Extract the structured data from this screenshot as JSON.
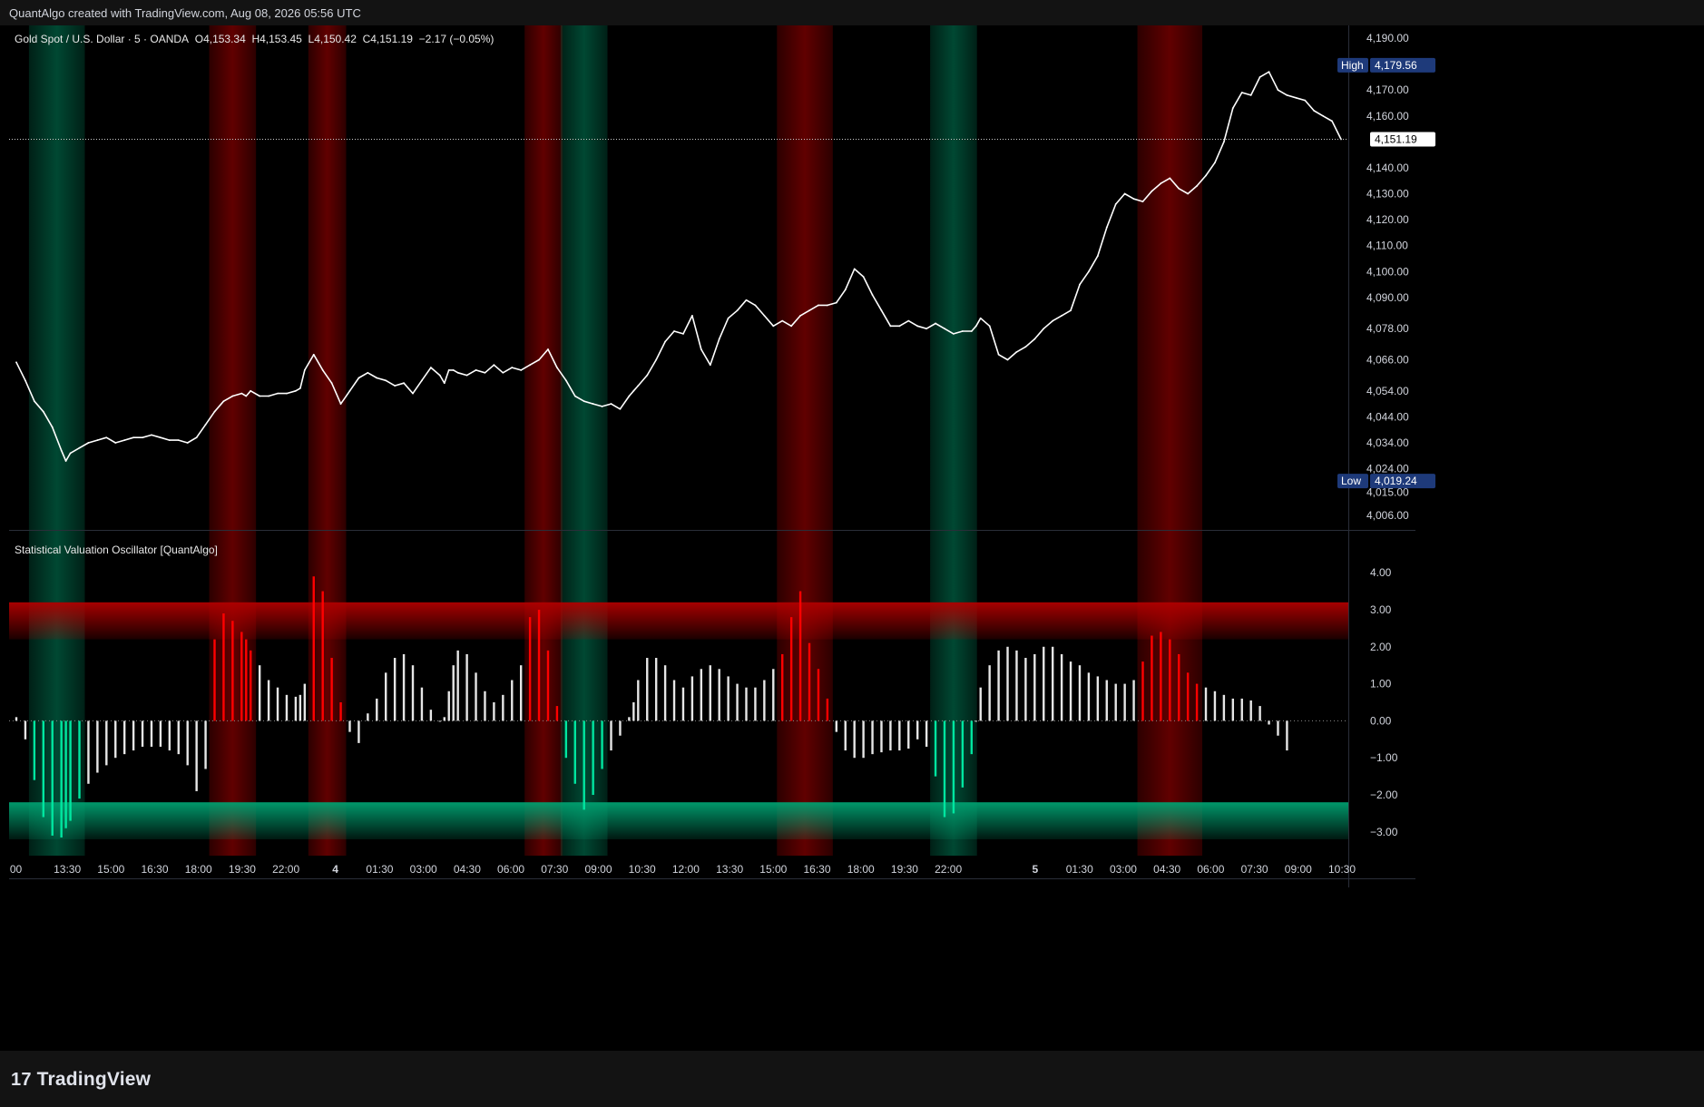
{
  "header": {
    "caption": "QuantAlgo created with TradingView.com, Aug 08, 2026 05:56 UTC"
  },
  "main_legend": {
    "symbol": "Gold Spot / U.S. Dollar · 5 · OANDA",
    "open": "O4,153.34",
    "high": "H4,153.45",
    "low": "L4,150.42",
    "close": "C4,151.19",
    "change": "−2.17 (−0.05%)"
  },
  "osc_legend": {
    "name": "Statistical Valuation Oscillator [QuantAlgo]"
  },
  "footer": {
    "logo_text": "TradingView",
    "logo_mark": "17"
  },
  "colors": {
    "background": "#000000",
    "price_line": "#ffffff",
    "osc_neutral": "#e6e6e6",
    "osc_over": "#ff0000",
    "osc_under": "#00e6a0",
    "red_zone": "#b00000",
    "green_zone": "#00a070",
    "badge": "#1e3a7a"
  },
  "chart_data": [
    {
      "type": "line",
      "title": "Gold Spot / U.S. Dollar · 5 · OANDA",
      "x_ticks": [
        "00",
        "13:30",
        "15:00",
        "16:30",
        "18:00",
        "19:30",
        "22:00",
        "4",
        "01:30",
        "03:00",
        "04:30",
        "06:00",
        "07:30",
        "09:00",
        "10:30",
        "12:00",
        "13:30",
        "15:00",
        "16:30",
        "18:00",
        "19:30",
        "22:00",
        "5",
        "01:30",
        "03:00",
        "04:30",
        "06:00",
        "07:30",
        "09:00",
        "10:30"
      ],
      "y_ticks": [
        "4,190.00",
        "4,170.00",
        "4,160.00",
        "4,140.00",
        "4,130.00",
        "4,120.00",
        "4,110.00",
        "4,100.00",
        "4,090.00",
        "4,078.00",
        "4,066.00",
        "4,054.00",
        "4,044.00",
        "4,034.00",
        "4,024.00",
        "4,015.00",
        "4,006.00"
      ],
      "ylim": [
        4006,
        4190
      ],
      "x": [
        0,
        2,
        4,
        6,
        8,
        10,
        11,
        12,
        14,
        16,
        18,
        20,
        22,
        24,
        26,
        28,
        30,
        32,
        34,
        36,
        38,
        40,
        42,
        44,
        46,
        48,
        50,
        51,
        52,
        54,
        56,
        58,
        60,
        62,
        63,
        64,
        66,
        68,
        70,
        72,
        74,
        76,
        78,
        80,
        82,
        84,
        86,
        88,
        90,
        92,
        94,
        95,
        96,
        97,
        98,
        100,
        102,
        104,
        106,
        108,
        110,
        112,
        114,
        116,
        118,
        120,
        122,
        124,
        126,
        128,
        130,
        132,
        134,
        136,
        137,
        138,
        140,
        142,
        144,
        146,
        148,
        150,
        152,
        154,
        156,
        158,
        160,
        162,
        164,
        166,
        168,
        170,
        172,
        174,
        176,
        178,
        180,
        182,
        184,
        186,
        188,
        190,
        192,
        194,
        196,
        198,
        200,
        202,
        204,
        206,
        208,
        210,
        212,
        213,
        214,
        216,
        218,
        220,
        222,
        224,
        226,
        228,
        230,
        232,
        234,
        236,
        238,
        240,
        242,
        244,
        246,
        248,
        250,
        252,
        254,
        256,
        258,
        260,
        262,
        264,
        266,
        268,
        270,
        272,
        274,
        276,
        278,
        280,
        282,
        284,
        286,
        288,
        290,
        292,
        294
      ],
      "close": [
        4065,
        4058,
        4050,
        4046,
        4040,
        4031,
        4027,
        4030,
        4032,
        4034,
        4035,
        4036,
        4034,
        4035,
        4036,
        4036,
        4037,
        4036,
        4035,
        4035,
        4034,
        4036,
        4041,
        4046,
        4050,
        4052,
        4053,
        4052,
        4054,
        4052,
        4052,
        4053,
        4053,
        4054,
        4055,
        4062,
        4068,
        4062,
        4057,
        4049,
        4054,
        4059,
        4061,
        4059,
        4058,
        4056,
        4057,
        4053,
        4058,
        4063,
        4060,
        4057,
        4062,
        4062,
        4061,
        4060,
        4062,
        4061,
        4064,
        4061,
        4063,
        4062,
        4064,
        4066,
        4070,
        4063,
        4058,
        4052,
        4050,
        4049,
        4048,
        4049,
        4047,
        4052,
        4054,
        4056,
        4060,
        4066,
        4073,
        4077,
        4076,
        4083,
        4070,
        4064,
        4074,
        4082,
        4085,
        4089,
        4087,
        4083,
        4079,
        4081,
        4079,
        4083,
        4085,
        4087,
        4087,
        4088,
        4093,
        4101,
        4098,
        4091,
        4085,
        4079,
        4079,
        4081,
        4079,
        4078,
        4080,
        4078,
        4076,
        4077,
        4077,
        4079,
        4082,
        4079,
        4068,
        4066,
        4069,
        4071,
        4074,
        4078,
        4081,
        4083,
        4085,
        4095,
        4100,
        4106,
        4117,
        4126,
        4130,
        4128,
        4127,
        4131,
        4134,
        4136,
        4132,
        4130,
        4133,
        4137,
        4142,
        4150,
        4163,
        4169,
        4168,
        4175,
        4177,
        4170,
        4168,
        4167,
        4166,
        4162,
        4160,
        4158,
        4151
      ]
    },
    {
      "type": "bar",
      "title": "Statistical Valuation Oscillator [QuantAlgo]",
      "y_ticks": [
        "4.00",
        "3.00",
        "2.00",
        "1.00",
        "0.00",
        "-1.00",
        "-2.00",
        "-3.00"
      ],
      "ylim": [
        -3.2,
        4.2
      ],
      "overbought_zone": [
        2.2,
        3.2
      ],
      "oversold_zone": [
        -3.2,
        -2.2
      ],
      "x": [
        0,
        2,
        4,
        6,
        8,
        10,
        11,
        12,
        14,
        16,
        18,
        20,
        22,
        24,
        26,
        28,
        30,
        32,
        34,
        36,
        38,
        40,
        42,
        44,
        46,
        48,
        50,
        51,
        52,
        54,
        56,
        58,
        60,
        62,
        63,
        64,
        66,
        68,
        70,
        72,
        74,
        76,
        78,
        80,
        82,
        84,
        86,
        88,
        90,
        92,
        94,
        95,
        96,
        97,
        98,
        100,
        102,
        104,
        106,
        108,
        110,
        112,
        114,
        116,
        118,
        120,
        122,
        124,
        126,
        128,
        130,
        132,
        134,
        136,
        137,
        138,
        140,
        142,
        144,
        146,
        148,
        150,
        152,
        154,
        156,
        158,
        160,
        162,
        164,
        166,
        168,
        170,
        172,
        174,
        176,
        178,
        180,
        182,
        184,
        186,
        188,
        190,
        192,
        194,
        196,
        198,
        200,
        202,
        204,
        206,
        208,
        210,
        212,
        213,
        214,
        216,
        218,
        220,
        222,
        224,
        226,
        228,
        230,
        232,
        234,
        236,
        238,
        240,
        242,
        244,
        246,
        248,
        250,
        252,
        254,
        256,
        258,
        260,
        262,
        264,
        266,
        268,
        270,
        272,
        274,
        276,
        278,
        280,
        282,
        284,
        286,
        288,
        290,
        292,
        294
      ],
      "values": [
        0.1,
        -0.5,
        -1.6,
        -2.6,
        -3.1,
        -3.15,
        -2.9,
        -2.7,
        -2.1,
        -1.7,
        -1.4,
        -1.2,
        -1.0,
        -0.9,
        -0.8,
        -0.7,
        -0.7,
        -0.7,
        -0.8,
        -0.9,
        -1.2,
        -1.9,
        -1.3,
        2.2,
        2.9,
        2.7,
        2.4,
        2.2,
        1.9,
        1.5,
        1.1,
        0.9,
        0.7,
        0.65,
        0.7,
        1.0,
        3.9,
        3.5,
        1.7,
        0.5,
        -0.3,
        -0.6,
        0.2,
        0.6,
        1.3,
        1.7,
        1.8,
        1.5,
        0.9,
        0.3,
        0.0,
        0.1,
        0.8,
        1.5,
        1.9,
        1.8,
        1.3,
        0.8,
        0.5,
        0.7,
        1.1,
        1.5,
        2.8,
        3.0,
        1.9,
        0.4,
        -1.0,
        -1.7,
        -2.4,
        -2.0,
        -1.3,
        -0.8,
        -0.4,
        0.1,
        0.5,
        1.1,
        1.7,
        1.7,
        1.5,
        1.1,
        0.9,
        1.2,
        1.4,
        1.5,
        1.4,
        1.2,
        1.0,
        0.9,
        0.9,
        1.1,
        1.4,
        1.8,
        2.8,
        3.5,
        2.1,
        1.4,
        0.6,
        -0.3,
        -0.8,
        -1.0,
        -1.0,
        -0.9,
        -0.85,
        -0.8,
        -0.8,
        -0.75,
        -0.5,
        -0.7,
        -1.5,
        -2.6,
        -2.5,
        -1.8,
        -0.9,
        0.0,
        0.9,
        1.5,
        1.9,
        2.0,
        1.9,
        1.7,
        1.8,
        2.0,
        2.0,
        1.8,
        1.6,
        1.5,
        1.3,
        1.2,
        1.1,
        1.0,
        1.0,
        1.1,
        1.6,
        2.3,
        2.4,
        2.2,
        1.8,
        1.3,
        1.0,
        0.9,
        0.8,
        0.7,
        0.6,
        0.6,
        0.55,
        0.4,
        -0.1,
        -0.4,
        -0.8
      ],
      "over_sections": [
        [
          23,
          28
        ],
        [
          36,
          39
        ],
        [
          62,
          65
        ],
        [
          91,
          96
        ],
        [
          132,
          138
        ]
      ],
      "under_sections": [
        [
          2,
          8
        ],
        [
          66,
          70
        ],
        [
          108,
          112
        ]
      ]
    }
  ],
  "signal_bands": [
    {
      "from": 2,
      "to": 8,
      "kind": "buy"
    },
    {
      "from": 23,
      "to": 28,
      "kind": "sell"
    },
    {
      "from": 36,
      "to": 39,
      "kind": "sell"
    },
    {
      "from": 62,
      "to": 65,
      "kind": "sell"
    },
    {
      "from": 66,
      "to": 70,
      "kind": "buy"
    },
    {
      "from": 91,
      "to": 96,
      "kind": "sell"
    },
    {
      "from": 108,
      "to": 112,
      "kind": "buy"
    },
    {
      "from": 132,
      "to": 138,
      "kind": "sell"
    }
  ],
  "price_axis": {
    "high_label": "High",
    "high_value": "4,179.56",
    "low_label": "Low",
    "low_value": "4,019.24",
    "last_value": "4,151.19"
  }
}
